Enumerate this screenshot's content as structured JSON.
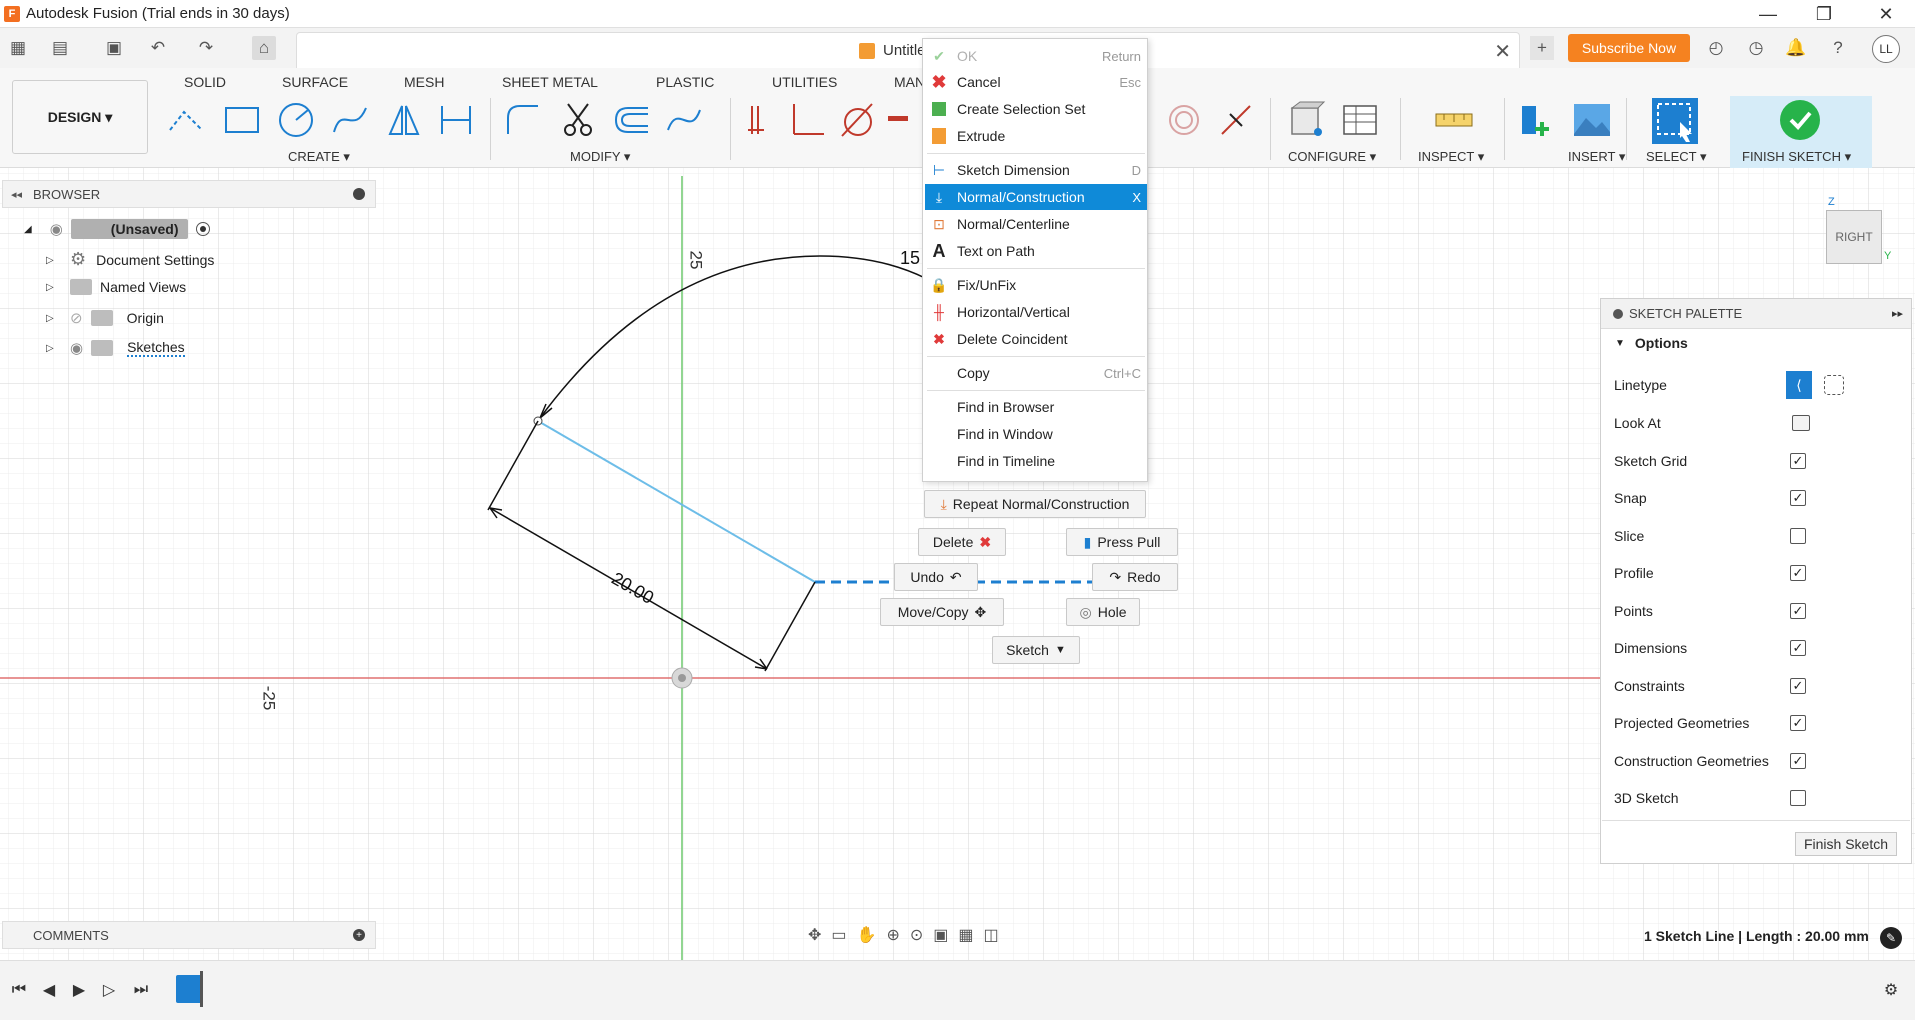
{
  "window": {
    "title": "Autodesk Fusion (Trial ends in 30 days)",
    "logo_letter": "F"
  },
  "app_bar": {
    "doc_tab_label": "Untitled",
    "subscribe_label": "Subscribe Now",
    "avatar_initials": "LL",
    "icons": [
      "grid-icon",
      "file-icon",
      "save-icon",
      "undo-icon",
      "redo-icon",
      "home-icon",
      "plus-icon",
      "clock-icon",
      "history-icon",
      "bell-icon",
      "help-icon"
    ]
  },
  "ribbon": {
    "workspace_label": "DESIGN ▾",
    "tabs": [
      "SOLID",
      "SURFACE",
      "MESH",
      "SHEET METAL",
      "PLASTIC",
      "UTILITIES",
      "MAN"
    ],
    "groups": {
      "create": "CREATE ▾",
      "modify": "MODIFY ▾",
      "configure": "CONFIGURE ▾",
      "inspect": "INSPECT ▾",
      "insert": "INSERT ▾",
      "select": "SELECT ▾",
      "finish": "FINISH SKETCH ▾"
    },
    "accent": "#0f8ad8",
    "finish_color": "#27b34a"
  },
  "browser": {
    "title": "BROWSER",
    "root_label": "(Unsaved)",
    "items": [
      {
        "label": "Document Settings"
      },
      {
        "label": "Named Views"
      },
      {
        "label": "Origin"
      },
      {
        "label": "Sketches"
      }
    ]
  },
  "canvas": {
    "dim_20": "20.00",
    "dim_15": "15",
    "axis_25": "25",
    "axis_neg25": "-25",
    "viewcube_label": "RIGHT",
    "viewcube_z": "Z",
    "viewcube_y": "Y"
  },
  "context_menu": {
    "items": [
      {
        "label": "OK",
        "shortcut": "Return",
        "disabled": true
      },
      {
        "label": "Cancel",
        "shortcut": "Esc"
      },
      {
        "label": "Create Selection Set",
        "shortcut": ""
      },
      {
        "label": "Extrude",
        "shortcut": ""
      },
      {
        "label": "Sketch Dimension",
        "shortcut": "D"
      },
      {
        "label": "Normal/Construction",
        "shortcut": "X",
        "active": true
      },
      {
        "label": "Normal/Centerline",
        "shortcut": ""
      },
      {
        "label": "Text on Path",
        "shortcut": ""
      },
      {
        "label": "Fix/UnFix",
        "shortcut": ""
      },
      {
        "label": "Horizontal/Vertical",
        "shortcut": ""
      },
      {
        "label": "Delete Coincident",
        "shortcut": ""
      },
      {
        "label": "Copy",
        "shortcut": "Ctrl+C"
      },
      {
        "label": "Find in Browser",
        "shortcut": ""
      },
      {
        "label": "Find in Window",
        "shortcut": ""
      },
      {
        "label": "Find in Timeline",
        "shortcut": ""
      }
    ],
    "repeat_label": "Repeat Normal/Construction"
  },
  "marking_menu": {
    "delete": "Delete",
    "press_pull": "Press Pull",
    "undo": "Undo",
    "redo": "Redo",
    "move_copy": "Move/Copy",
    "hole": "Hole",
    "sketch": "Sketch"
  },
  "sketch_palette": {
    "title": "SKETCH PALETTE",
    "options_header": "Options",
    "rows": [
      {
        "label": "Linetype",
        "kind": "linetype"
      },
      {
        "label": "Look At",
        "kind": "lookat"
      },
      {
        "label": "Sketch Grid",
        "checked": true
      },
      {
        "label": "Snap",
        "checked": true
      },
      {
        "label": "Slice",
        "checked": false
      },
      {
        "label": "Profile",
        "checked": true
      },
      {
        "label": "Points",
        "checked": true
      },
      {
        "label": "Dimensions",
        "checked": true
      },
      {
        "label": "Constraints",
        "checked": true
      },
      {
        "label": "Projected Geometries",
        "checked": true
      },
      {
        "label": "Construction Geometries",
        "checked": true
      },
      {
        "label": "3D Sketch",
        "checked": false
      }
    ],
    "finish_label": "Finish Sketch"
  },
  "comments": {
    "title": "COMMENTS"
  },
  "status": {
    "text": "1 Sketch Line | Length : 20.00 mm"
  }
}
